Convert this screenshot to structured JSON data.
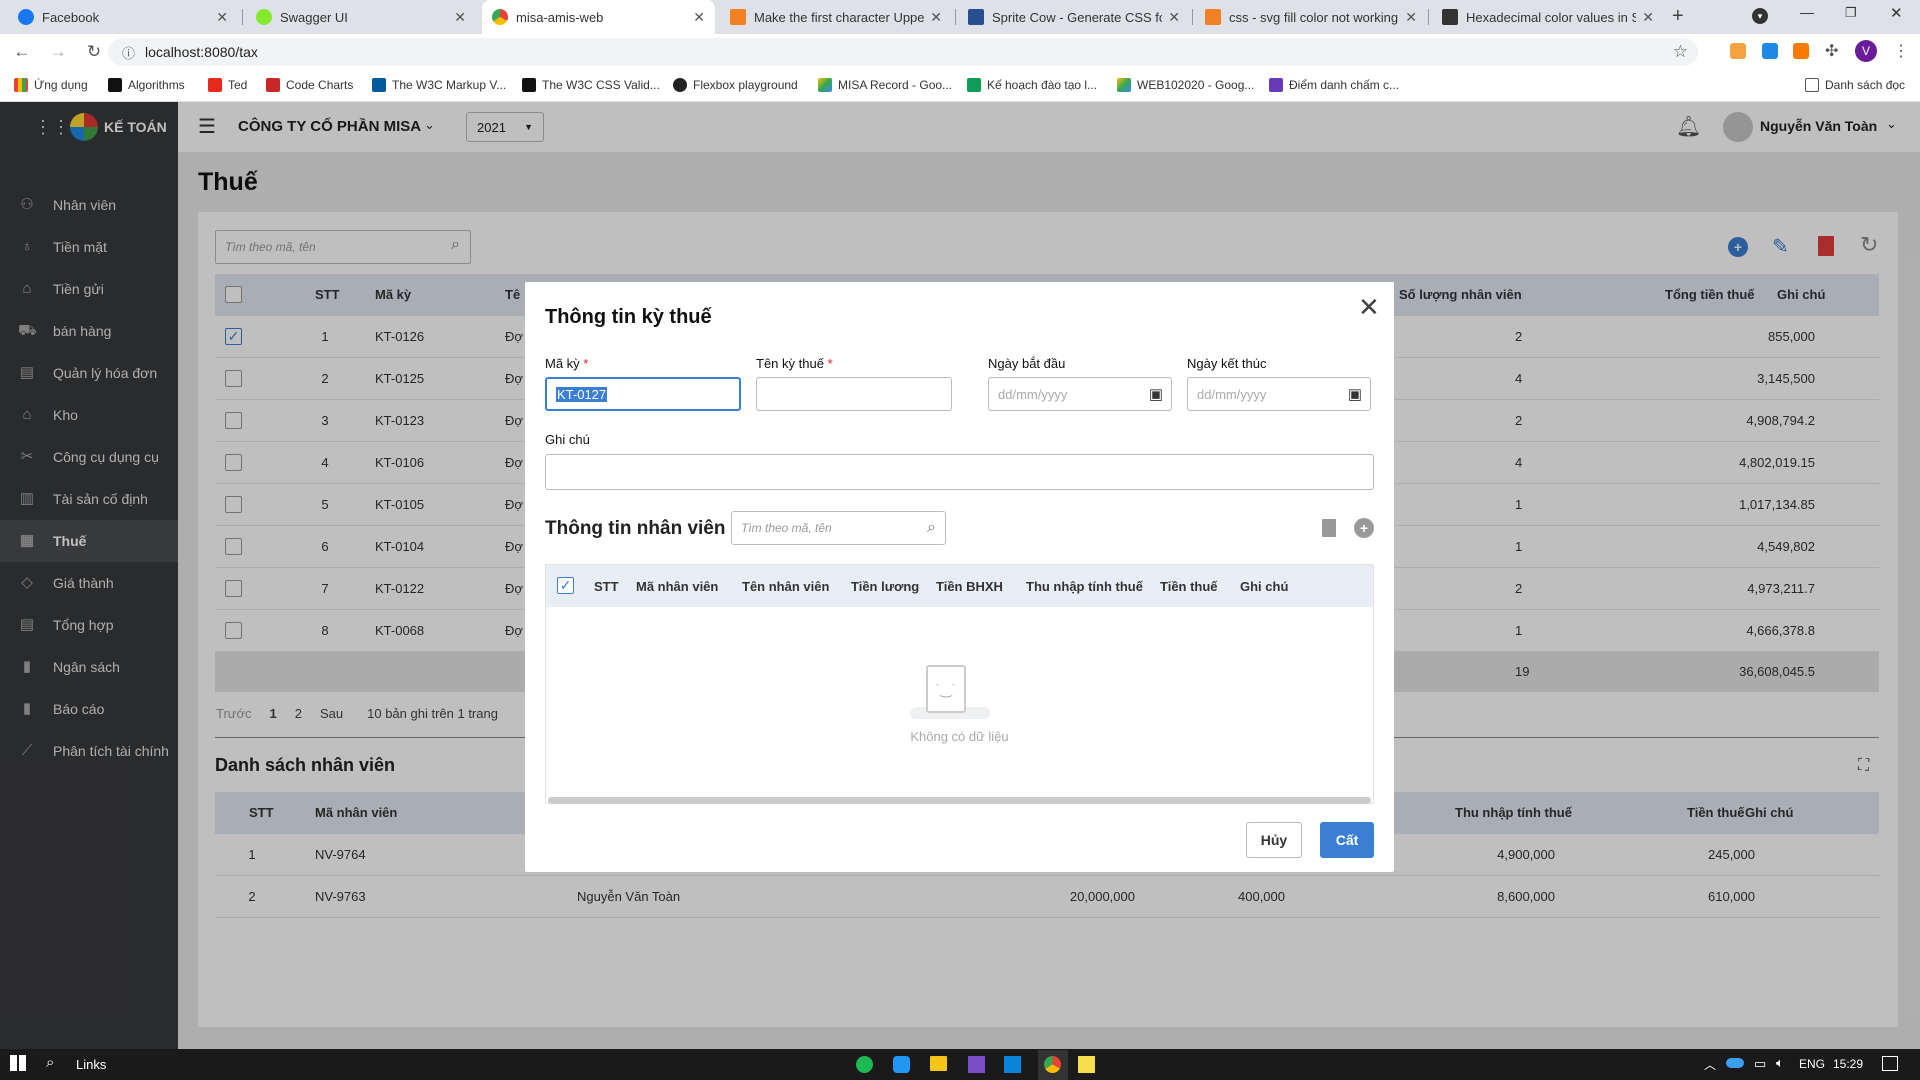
{
  "browser": {
    "tabs": [
      {
        "title": "Facebook",
        "color": "#1877f2"
      },
      {
        "title": "Swagger UI",
        "color": "#85ea2d"
      },
      {
        "title": "misa-amis-web",
        "color": "#4285f4"
      },
      {
        "title": "Make the first character Upperca",
        "color": "#f48024"
      },
      {
        "title": "Sprite Cow - Generate CSS for sp",
        "color": "#2a4f8f"
      },
      {
        "title": "css - svg fill color not working w",
        "color": "#f48024"
      },
      {
        "title": "Hexadecimal color values in SVG",
        "color": "#333333"
      }
    ],
    "url": "localhost:8080/tax",
    "bookmarks": [
      "Ứng dụng",
      "Algorithms",
      "Ted",
      "Code Charts",
      "The W3C Markup V...",
      "The W3C CSS Valid...",
      "Flexbox playground",
      "MISA Record - Goo...",
      "Kế hoạch đào tạo l...",
      "WEB102020 - Goog...",
      "Điểm danh chấm c..."
    ],
    "reading_list": "Danh sách đọc"
  },
  "app": {
    "brand": "KẾ TOÁN",
    "company": "CÔNG TY CỔ PHẦN MISA",
    "year": "2021",
    "user": "Nguyễn Văn Toàn",
    "page_title": "Thuế",
    "search_placeholder": "Tìm theo mã, tên"
  },
  "sidebar": [
    {
      "label": "Nhân viên",
      "icon": "employee-icon"
    },
    {
      "label": "Tiền mặt",
      "icon": "cash-icon"
    },
    {
      "label": "Tiền gửi",
      "icon": "deposit-icon"
    },
    {
      "label": "bán hàng",
      "icon": "cart-icon"
    },
    {
      "label": "Quản lý hóa đơn",
      "icon": "invoice-icon"
    },
    {
      "label": "Kho",
      "icon": "warehouse-icon"
    },
    {
      "label": "Công cụ dụng cụ",
      "icon": "tools-icon"
    },
    {
      "label": "Tài sản cố định",
      "icon": "asset-icon"
    },
    {
      "label": "Thuế",
      "icon": "tax-icon",
      "active": true
    },
    {
      "label": "Giá thành",
      "icon": "price-tag-icon"
    },
    {
      "label": "Tổng hợp",
      "icon": "summary-icon"
    },
    {
      "label": "Ngân sách",
      "icon": "budget-icon"
    },
    {
      "label": "Báo cáo",
      "icon": "report-icon"
    },
    {
      "label": "Phân tích tài chính",
      "icon": "analysis-icon"
    }
  ],
  "tax_table": {
    "headers": {
      "stt": "STT",
      "code": "Mã kỳ",
      "name": "Tê",
      "count": "Số lượng nhân viên",
      "total": "Tổng tiền thuế",
      "note": "Ghi chú"
    },
    "rows": [
      {
        "stt": "1",
        "code": "KT-0126",
        "name": "Đợ",
        "count": "2",
        "total": "855,000",
        "checked": true
      },
      {
        "stt": "2",
        "code": "KT-0125",
        "name": "Đợ",
        "count": "4",
        "total": "3,145,500"
      },
      {
        "stt": "3",
        "code": "KT-0123",
        "name": "Đợ",
        "count": "2",
        "total": "4,908,794.2"
      },
      {
        "stt": "4",
        "code": "KT-0106",
        "name": "Đợ",
        "count": "4",
        "total": "4,802,019.15"
      },
      {
        "stt": "5",
        "code": "KT-0105",
        "name": "Đợ",
        "count": "1",
        "total": "1,017,134.85"
      },
      {
        "stt": "6",
        "code": "KT-0104",
        "name": "Đợ",
        "count": "1",
        "total": "4,549,802"
      },
      {
        "stt": "7",
        "code": "KT-0122",
        "name": "Đợ",
        "count": "2",
        "total": "4,973,211.7"
      },
      {
        "stt": "8",
        "code": "KT-0068",
        "name": "Đợ",
        "count": "1",
        "total": "4,666,378.8"
      }
    ],
    "footer": {
      "count": "19",
      "total": "36,608,045.5"
    },
    "pagination": {
      "prev": "Trước",
      "pages": [
        "1",
        "2"
      ],
      "next": "Sau",
      "info": "10 bản ghi trên 1 trang"
    }
  },
  "employee_list": {
    "title": "Danh sách nhân viên",
    "headers": {
      "stt": "STT",
      "code": "Mã nhân viên",
      "income": "Thu nhập tính thuế",
      "tax": "Tiền thuế",
      "note": "Ghi chú"
    },
    "rows": [
      {
        "stt": "1",
        "code": "NV-9764",
        "name": "",
        "salary": "",
        "insurance": "",
        "income": "4,900,000",
        "tax": "245,000"
      },
      {
        "stt": "2",
        "code": "NV-9763",
        "name": "Nguyễn Văn Toàn",
        "salary": "20,000,000",
        "insurance": "400,000",
        "income": "8,600,000",
        "tax": "610,000"
      }
    ]
  },
  "modal": {
    "title": "Thông tin kỳ thuế",
    "code_label": "Mã kỳ",
    "code_value": "KT-0127",
    "name_label": "Tên kỳ thuế",
    "start_label": "Ngày bắt đầu",
    "end_label": "Ngày kết thúc",
    "date_placeholder": "dd/mm/yyyy",
    "note_label": "Ghi chú",
    "section_title": "Thông tin nhân viên",
    "search_placeholder": "Tìm theo mã, tên",
    "columns": [
      "STT",
      "Mã nhân viên",
      "Tên nhân viên",
      "Tiền lương",
      "Tiền BHXH",
      "Thu nhập tính thuế",
      "Tiền thuế",
      "Ghi chú"
    ],
    "empty_text": "Không có dữ liệu",
    "cancel": "Hủy",
    "save": "Cất"
  },
  "taskbar": {
    "search": "Links",
    "lang": "ENG",
    "time": "15:29"
  },
  "colors": {
    "accent": "#3b7fd4",
    "sidebar": "#393a3d",
    "delete": "#e23c3c"
  }
}
